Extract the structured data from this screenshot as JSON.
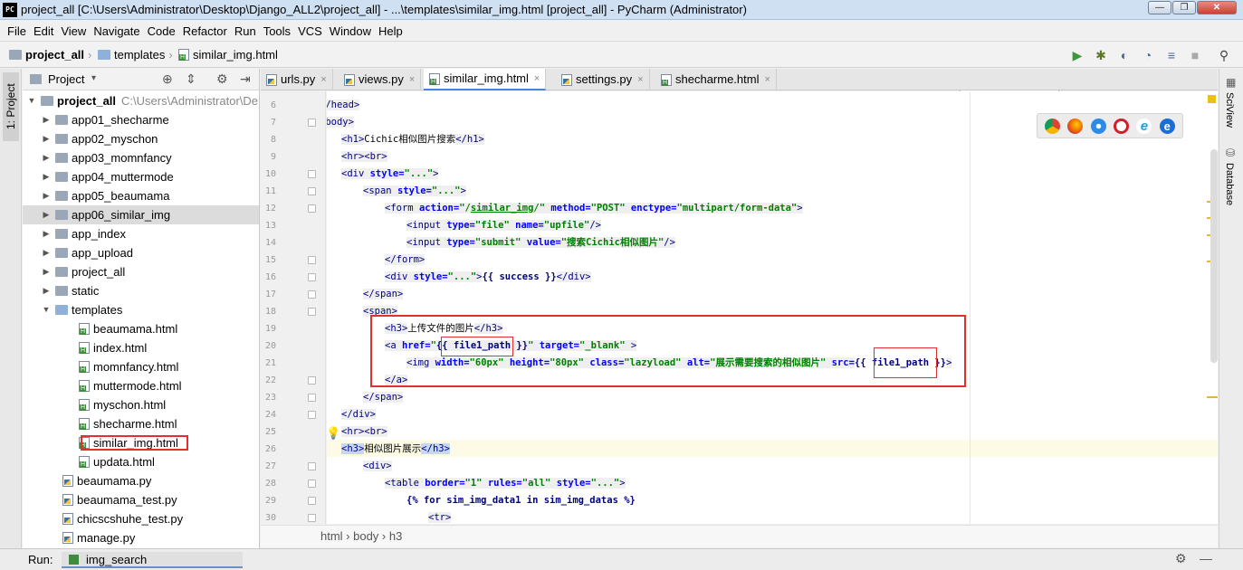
{
  "window": {
    "app_icon": "PC",
    "title": "project_all [C:\\Users\\Administrator\\Desktop\\Django_ALL2\\project_all] - ...\\templates\\similar_img.html [project_all] - PyCharm (Administrator)",
    "minimize": "—",
    "maximize": "❐",
    "close": "✕"
  },
  "menu": [
    "File",
    "Edit",
    "View",
    "Navigate",
    "Code",
    "Refactor",
    "Run",
    "Tools",
    "VCS",
    "Window",
    "Help"
  ],
  "nav": {
    "project": "project_all",
    "folder": "templates",
    "file": "similar_img.html",
    "run_config": "img_search"
  },
  "toolbar_icons": [
    "run-icon",
    "debug-icon",
    "coverage-icon",
    "profile-icon",
    "build-icon",
    "stop-icon",
    "search-icon"
  ],
  "project_panel": {
    "title": "Project",
    "root": "project_all",
    "root_path": "C:\\Users\\Administrator\\De",
    "items": [
      {
        "label": "app01_shecharme",
        "kind": "folder"
      },
      {
        "label": "app02_myschon",
        "kind": "folder"
      },
      {
        "label": "app03_momnfancy",
        "kind": "folder"
      },
      {
        "label": "app04_muttermode",
        "kind": "folder"
      },
      {
        "label": "app05_beaumama",
        "kind": "folder"
      },
      {
        "label": "app06_similar_img",
        "kind": "folder"
      },
      {
        "label": "app_index",
        "kind": "folder"
      },
      {
        "label": "app_upload",
        "kind": "folder"
      },
      {
        "label": "project_all",
        "kind": "folder"
      },
      {
        "label": "static",
        "kind": "folder"
      },
      {
        "label": "templates",
        "kind": "folder-open"
      },
      {
        "label": "beaumama.html",
        "kind": "html"
      },
      {
        "label": "index.html",
        "kind": "html"
      },
      {
        "label": "momnfancy.html",
        "kind": "html"
      },
      {
        "label": "muttermode.html",
        "kind": "html"
      },
      {
        "label": "myschon.html",
        "kind": "html"
      },
      {
        "label": "shecharme.html",
        "kind": "html"
      },
      {
        "label": "similar_img.html",
        "kind": "html"
      },
      {
        "label": "updata.html",
        "kind": "html"
      },
      {
        "label": "beaumama.py",
        "kind": "py"
      },
      {
        "label": "beaumama_test.py",
        "kind": "py"
      },
      {
        "label": "chicscshuhe_test.py",
        "kind": "py"
      },
      {
        "label": "manage.py",
        "kind": "py"
      }
    ]
  },
  "tabs": [
    "urls.py",
    "views.py",
    "similar_img.html",
    "settings.py",
    "shecharme.html"
  ],
  "tab_close": "×",
  "line_numbers": [
    "6",
    "7",
    "8",
    "9",
    "10",
    "11",
    "12",
    "13",
    "14",
    "15",
    "16",
    "17",
    "18",
    "19",
    "20",
    "21",
    "22",
    "23",
    "24",
    "25",
    "26",
    "27",
    "28",
    "29",
    "30"
  ],
  "browsers": [
    "chrome-icon",
    "firefox-icon",
    "safari-icon",
    "opera-icon",
    "ie-icon",
    "edge-icon"
  ],
  "breadcrumb": "html › body › h3",
  "right_tabs": [
    "SciView",
    "Database"
  ],
  "status": {
    "run_label": "Run:",
    "run_config": "img_search"
  }
}
